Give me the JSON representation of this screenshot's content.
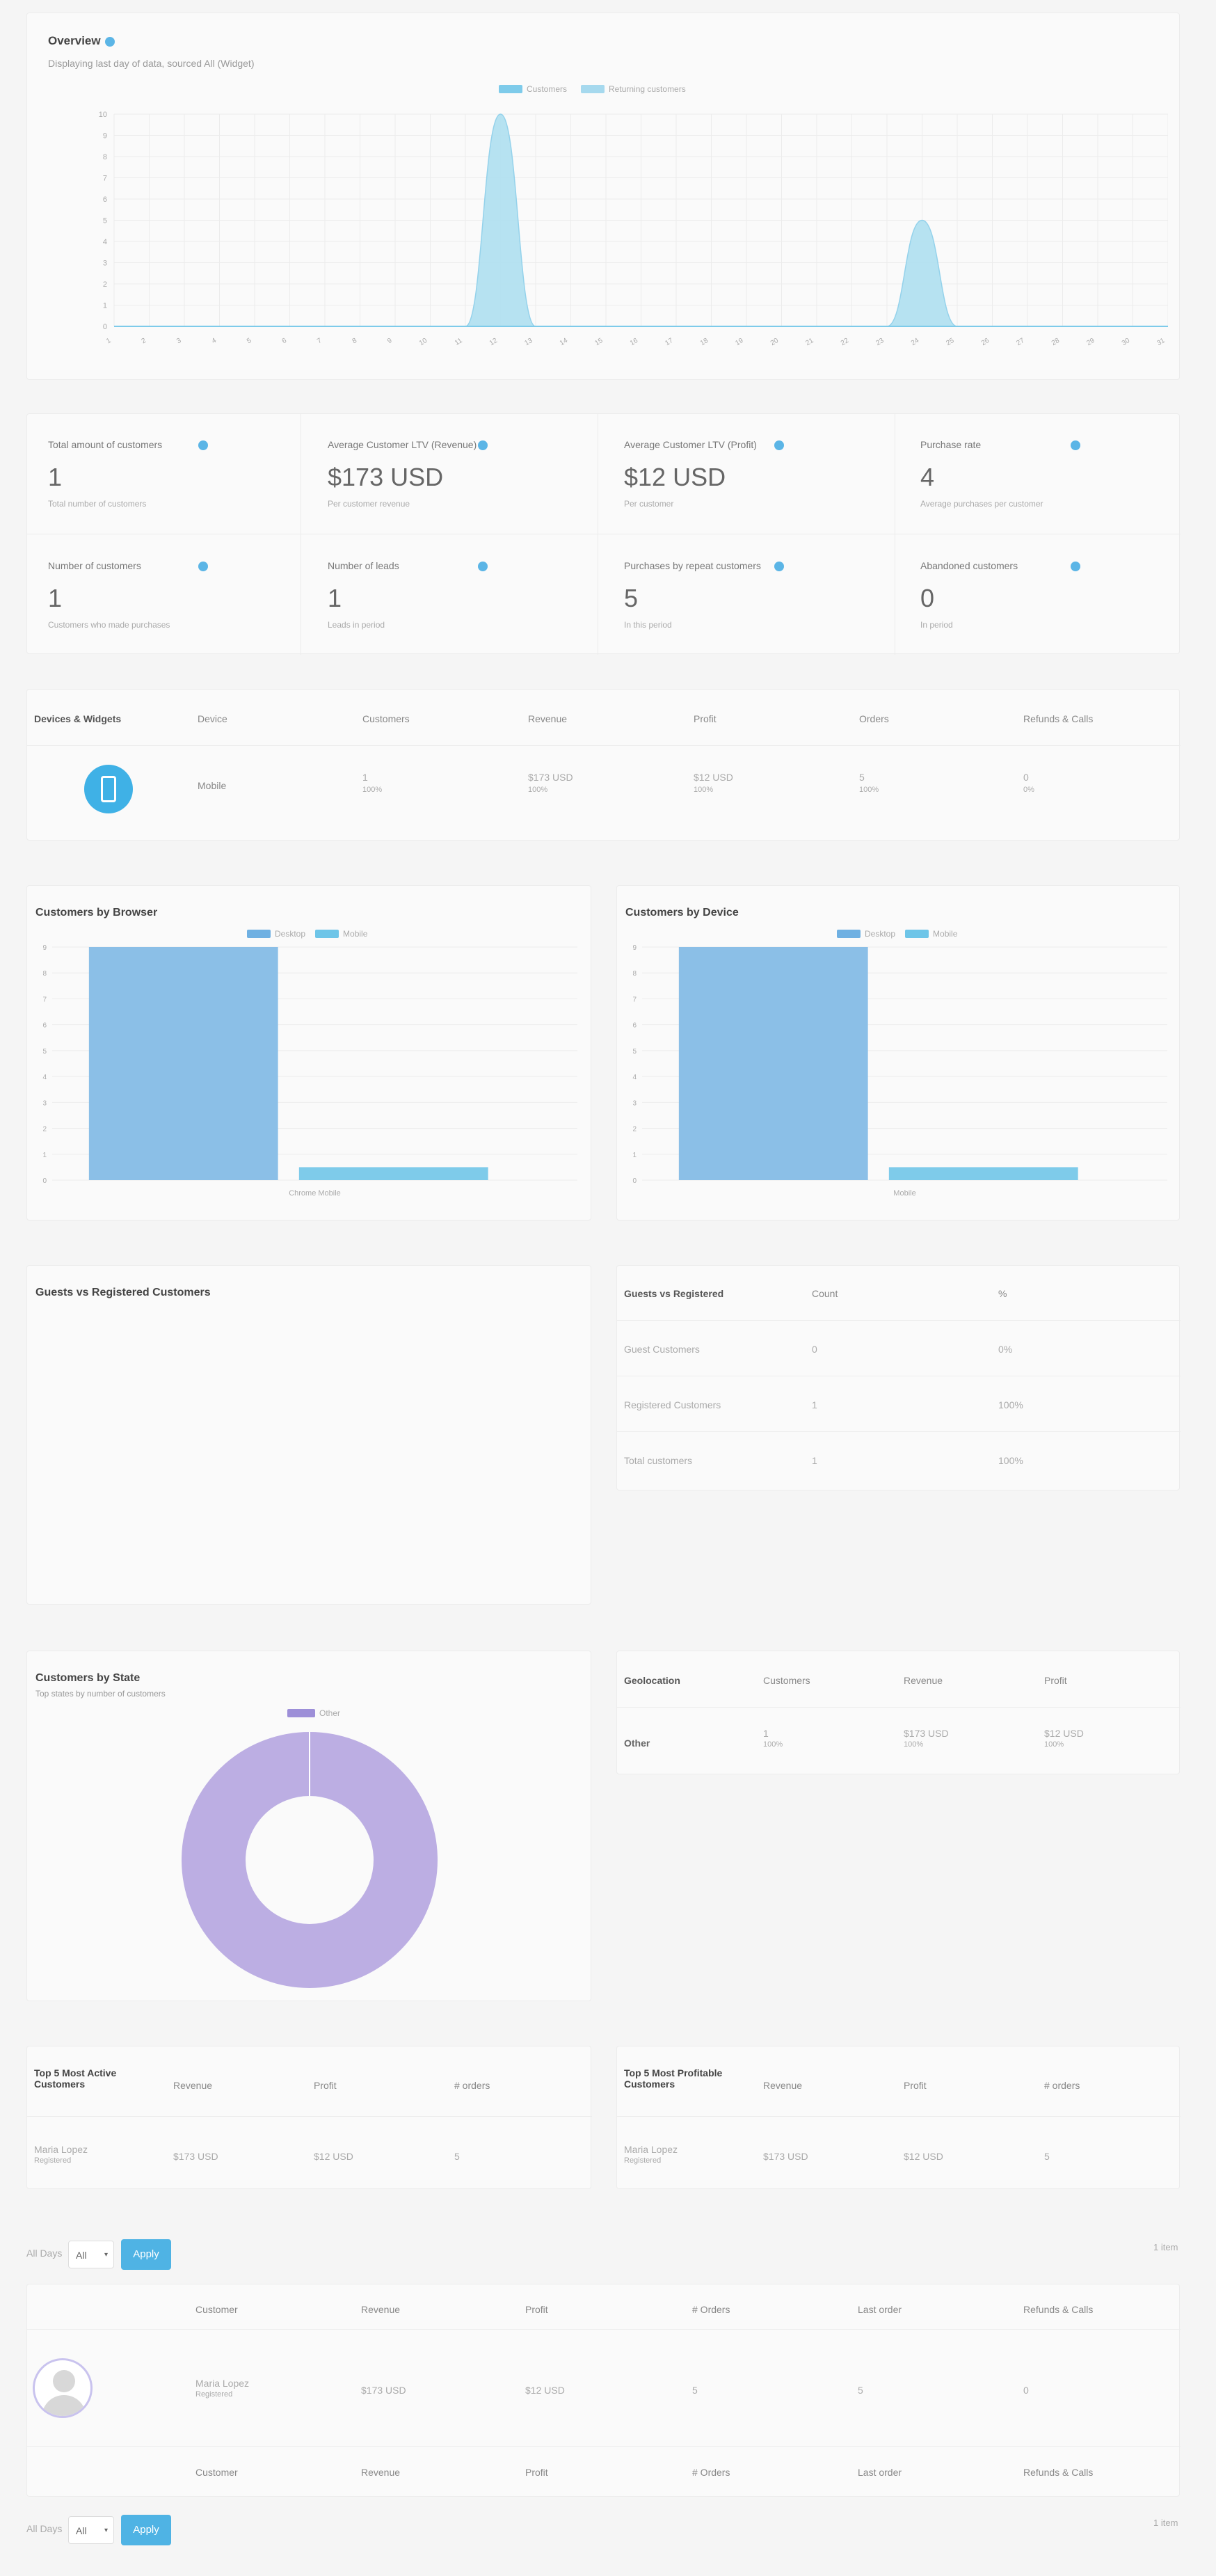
{
  "overview": {
    "title": "Overview",
    "subtitle": "Displaying last day of data, sourced All (Widget)",
    "legend": [
      "Customers",
      "Returning customers"
    ],
    "chart_data": {
      "type": "area",
      "x": [
        "1",
        "2",
        "3",
        "4",
        "5",
        "6",
        "7",
        "8",
        "9",
        "10",
        "11",
        "12",
        "13",
        "14",
        "15",
        "16",
        "17",
        "18",
        "19",
        "20",
        "21",
        "22",
        "23",
        "24",
        "25",
        "26",
        "27",
        "28",
        "29",
        "30",
        "31"
      ],
      "series": [
        {
          "name": "Customers",
          "values": [
            0,
            0,
            0,
            0,
            0,
            0,
            0,
            0,
            0,
            0,
            0,
            10,
            0,
            0,
            0,
            0,
            0,
            0,
            0,
            0,
            0,
            0,
            0,
            5,
            0,
            0,
            0,
            0,
            0,
            0,
            0
          ]
        },
        {
          "name": "Returning customers",
          "values": [
            0,
            0,
            0,
            0,
            0,
            0,
            0,
            0,
            0,
            0,
            0,
            0,
            0,
            0,
            0,
            0,
            0,
            0,
            0,
            0,
            0,
            0,
            0,
            0,
            0,
            0,
            0,
            0,
            0,
            0,
            0
          ]
        }
      ],
      "ylim": [
        0,
        10
      ],
      "yticks": [
        "0",
        "1",
        "2",
        "3",
        "4",
        "5",
        "6",
        "7",
        "8",
        "9",
        "10"
      ],
      "grid": true,
      "legend_position": "top-center",
      "colors": [
        "#b3e1f1",
        "#8ccfe8"
      ]
    }
  },
  "kpis": [
    {
      "label": "Total amount of customers",
      "value": "1",
      "note": "Total number of customers"
    },
    {
      "label": "Average Customer LTV (Revenue)",
      "value": "$173 USD",
      "note": "Per customer revenue"
    },
    {
      "label": "Average Customer LTV (Profit)",
      "value": "$12 USD",
      "note": "Per customer"
    },
    {
      "label": "Purchase rate",
      "value": "4",
      "note": "Average purchases per customer"
    },
    {
      "label": "Number of customers",
      "value": "1",
      "note": "Customers who made purchases"
    },
    {
      "label": "Number of leads",
      "value": "1",
      "note": "Leads in period"
    },
    {
      "label": "Purchases by repeat customers",
      "value": "5",
      "note": "In this period"
    },
    {
      "label": "Abandoned customers",
      "value": "0",
      "note": "In period"
    }
  ],
  "devices_table": {
    "headers": [
      "Devices & Widgets",
      "Device",
      "Customers",
      "Revenue",
      "Profit",
      "Orders",
      "Refunds & Calls"
    ],
    "rows": [
      {
        "device": "Mobile",
        "customers": "1",
        "customers_sub": "100%",
        "revenue": "$173 USD",
        "revenue_sub": "100%",
        "profit": "$12 USD",
        "profit_sub": "100%",
        "orders": "5",
        "orders_sub": "100%",
        "refunds": "0",
        "refunds_sub": "0%"
      }
    ]
  },
  "browser_chart": {
    "title": "Customers by Browser",
    "legend": [
      "Desktop",
      "Mobile"
    ],
    "chart_data": {
      "type": "bar",
      "categories": [
        "Chrome Mobile"
      ],
      "series": [
        {
          "name": "Desktop",
          "values": [
            9
          ]
        },
        {
          "name": "Mobile",
          "values": [
            0.5
          ]
        }
      ],
      "ylim": [
        0,
        9
      ],
      "yticks": [
        "0",
        "1",
        "2",
        "3",
        "4",
        "5",
        "6",
        "7",
        "8",
        "9"
      ],
      "colors": [
        "#8bbfe7",
        "#7ecbea"
      ]
    }
  },
  "device_chart": {
    "title": "Customers by Device",
    "legend": [
      "Desktop",
      "Mobile"
    ],
    "chart_data": {
      "type": "bar",
      "categories": [
        "Mobile"
      ],
      "series": [
        {
          "name": "Desktop",
          "values": [
            9
          ]
        },
        {
          "name": "Mobile",
          "values": [
            0.5
          ]
        }
      ],
      "ylim": [
        0,
        9
      ],
      "yticks": [
        "0",
        "1",
        "2",
        "3",
        "4",
        "5",
        "6",
        "7",
        "8",
        "9"
      ],
      "colors": [
        "#8bbfe7",
        "#7ecbea"
      ]
    }
  },
  "guests_chart": {
    "title": "Guests vs Registered Customers"
  },
  "guests_table": {
    "headers": [
      "Guests vs Registered",
      "Count",
      "%"
    ],
    "rows": [
      {
        "label": "Guest Customers",
        "count": "0",
        "pct": "0%"
      },
      {
        "label": "Registered Customers",
        "count": "1",
        "pct": "100%"
      },
      {
        "label": "Total customers",
        "count": "1",
        "pct": "100%"
      }
    ]
  },
  "state_chart": {
    "title": "Customers by State",
    "subtitle": "Top states by number of customers",
    "legend": [
      "Other"
    ],
    "chart_data": {
      "type": "pie",
      "categories": [
        "Other"
      ],
      "values": [
        1
      ],
      "colors": [
        "#bcaee3"
      ]
    }
  },
  "geo_table": {
    "headers": [
      "Geolocation",
      "Customers",
      "Revenue",
      "Profit"
    ],
    "rows": [
      {
        "label": "Other",
        "customers": "1",
        "customers_sub": "100%",
        "revenue": "$173 USD",
        "revenue_sub": "100%",
        "profit": "$12 USD",
        "profit_sub": "100%"
      }
    ]
  },
  "top_active": {
    "title": "Top 5 Most Active Customers",
    "headers": [
      "Revenue",
      "Profit",
      "# orders"
    ],
    "rows": [
      {
        "name": "Maria Lopez",
        "sub": "Registered",
        "revenue": "$173 USD",
        "profit": "$12 USD",
        "orders": "5"
      }
    ]
  },
  "top_profitable": {
    "title": "Top 5 Most Profitable Customers",
    "headers": [
      "Revenue",
      "Profit",
      "# orders"
    ],
    "rows": [
      {
        "name": "Maria Lopez",
        "sub": "Registered",
        "revenue": "$173 USD",
        "profit": "$12 USD",
        "orders": "5"
      }
    ]
  },
  "controls": {
    "bulk_label": "All Days",
    "select_value": "All",
    "apply_label": "Apply",
    "count_label": "1 item"
  },
  "customers_table": {
    "headers": [
      "Customer",
      "Revenue",
      "Profit",
      "# Orders",
      "Last order",
      "Refunds & Calls"
    ],
    "row": {
      "name": "Maria Lopez",
      "sub": "Registered",
      "revenue": "$173 USD",
      "profit": "$12 USD",
      "orders": "5",
      "last": "5",
      "refunds": "0"
    }
  }
}
